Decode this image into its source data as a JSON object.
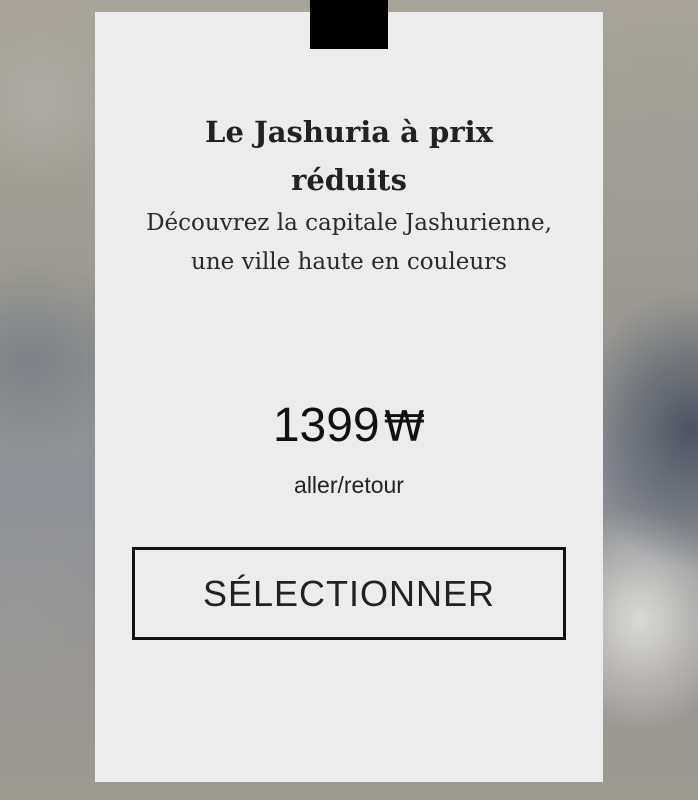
{
  "card": {
    "title": "Le  Jashuria à prix réduits",
    "description": "Découvrez la capitale Jashurienne, une ville haute en couleurs",
    "price": "1399",
    "currency": "₩",
    "price_note": "aller/retour",
    "select_label": "SÉLECTIONNER"
  },
  "colors": {
    "card_background": "#ececec",
    "tab": "#000000",
    "text": "#222222"
  }
}
